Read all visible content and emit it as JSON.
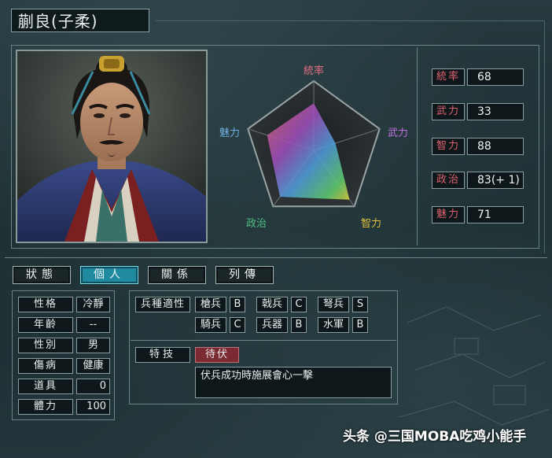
{
  "title": "蒯良(子柔)",
  "radar": {
    "labels": {
      "tongshuai": "統率",
      "wuli": "武力",
      "zhili": "智力",
      "zhengzhi": "政治",
      "meili": "魅力"
    },
    "colors": {
      "tongshuai": "#e07080",
      "wuli": "#c070e0",
      "zhili": "#e0c040",
      "zhengzhi": "#50c080",
      "meili": "#70b0e0"
    },
    "values": {
      "tongshuai": 68,
      "wuli": 33,
      "zhili": 88,
      "zhengzhi": 83,
      "meili": 71
    }
  },
  "stats": [
    {
      "label": "統率",
      "value": "68"
    },
    {
      "label": "武力",
      "value": "33"
    },
    {
      "label": "智力",
      "value": "88"
    },
    {
      "label": "政治",
      "value": "83(+ 1)"
    },
    {
      "label": "魅力",
      "value": "71"
    }
  ],
  "tabs": [
    "狀態",
    "個人",
    "關係",
    "列傳"
  ],
  "active_tab": "個人",
  "info": [
    {
      "label": "性格",
      "value": "冷靜"
    },
    {
      "label": "年齡",
      "value": "--"
    },
    {
      "label": "性別",
      "value": "男"
    },
    {
      "label": "傷病",
      "value": "健康"
    },
    {
      "label": "道具",
      "value": "0"
    },
    {
      "label": "體力",
      "value": "100"
    }
  ],
  "units": {
    "header": "兵種適性",
    "items": [
      {
        "name": "槍兵",
        "grade": "B"
      },
      {
        "name": "戟兵",
        "grade": "C"
      },
      {
        "name": "弩兵",
        "grade": "S"
      },
      {
        "name": "騎兵",
        "grade": "C"
      },
      {
        "name": "兵器",
        "grade": "B"
      },
      {
        "name": "水軍",
        "grade": "B"
      }
    ]
  },
  "skill": {
    "label": "特技",
    "name": "待伏",
    "description": "伏兵成功時施展會心一擊"
  },
  "watermark": "头条 @三国MOBA吃鸡小能手"
}
